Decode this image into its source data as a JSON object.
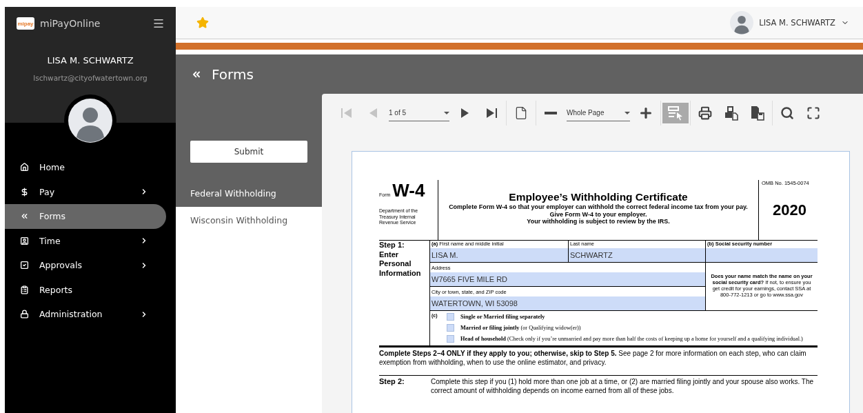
{
  "app": {
    "logo_text": "mipay",
    "name": "miPayOnline"
  },
  "user": {
    "name": "LISA M. SCHWARTZ",
    "email": "lschwartz@cityofwatertown.org"
  },
  "nav": [
    {
      "label": "Home",
      "kind": "home",
      "submenu": false,
      "selected": false
    },
    {
      "label": "Pay",
      "kind": "dollar",
      "submenu": true,
      "selected": false
    },
    {
      "label": "Forms",
      "kind": "rewind",
      "submenu": false,
      "selected": true
    },
    {
      "label": "Time",
      "kind": "badge",
      "submenu": true,
      "selected": false
    },
    {
      "label": "Approvals",
      "kind": "check",
      "submenu": true,
      "selected": false
    },
    {
      "label": "Reports",
      "kind": "clipboard",
      "submenu": false,
      "selected": false
    },
    {
      "label": "Administration",
      "kind": "lock",
      "submenu": true,
      "selected": false
    }
  ],
  "topbar": {
    "user_name": "LISA M. SCHWARTZ"
  },
  "page_title": "Forms",
  "submit_label": "Submit",
  "forms": [
    {
      "label": "Federal Withholding",
      "selected": true
    },
    {
      "label": "Wisconsin Withholding",
      "selected": false
    }
  ],
  "toolbar": [
    {
      "kind": "first",
      "disabled": true
    },
    {
      "kind": "prev",
      "disabled": true
    },
    {
      "kind": "select",
      "value": "1 of 5"
    },
    {
      "kind": "next",
      "disabled": false
    },
    {
      "kind": "last",
      "disabled": false
    },
    {
      "kind": "sep"
    },
    {
      "kind": "page",
      "disabled": false
    },
    {
      "kind": "sep"
    },
    {
      "kind": "zoomout",
      "disabled": false
    },
    {
      "kind": "select",
      "value": "Whole Page"
    },
    {
      "kind": "zoomin",
      "disabled": false
    },
    {
      "kind": "sep"
    },
    {
      "kind": "selecttool",
      "disabled": false,
      "selected": true
    },
    {
      "kind": "sep"
    },
    {
      "kind": "print",
      "disabled": false
    },
    {
      "kind": "download",
      "disabled": false
    },
    {
      "kind": "save",
      "disabled": false
    },
    {
      "kind": "sep"
    },
    {
      "kind": "search",
      "disabled": false
    },
    {
      "kind": "fullscreen",
      "disabled": false
    }
  ],
  "document": {
    "form_label": "Form",
    "form_number": "W-4",
    "department": "Department of the Treasury Internal Revenue Service",
    "title": "Employee’s Withholding Certificate",
    "instructions": [
      "Complete Form W-4 so that your employer can withhold the correct federal income tax from your pay.",
      "Give Form W-4 to your employer.",
      "Your withholding is subject to review by the IRS."
    ],
    "omb": "OMB No. 1545-0074",
    "year": "2020",
    "step1_label": "Step 1:",
    "step1_title": "Enter Personal Information",
    "name_fields": [
      {
        "label": "**(a)** First name and middle initial",
        "value": "LISA M."
      },
      {
        "label": "Last name",
        "value": "SCHWARTZ"
      },
      {
        "label": "**(b) Social security number**"
      }
    ],
    "address_fields": [
      {
        "label": "Address",
        "value": "W7665 FIVE MILE RD"
      },
      {
        "label": "City or town, state, and ZIP code",
        "value": "WATERTOWN, WI 53098"
      }
    ],
    "ssa_note": "**Does your name match the name on your social security card?** If not, to ensure you get credit for your earnings, contact SSA at 800-772-1213 or go to www.ssa.gov",
    "filing_label": "(c)",
    "filing_status": [
      {
        "label": "**Single or Married filing separately**",
        "checked": false
      },
      {
        "label": "**Married or filing jointly** (or Qualifying widow(er))",
        "checked": false
      },
      {
        "label": "**Head of household** (Check only if you’re unmarried and pay more than half the costs of keeping up a home for yourself and a qualifying individual.)",
        "checked": false
      }
    ],
    "note": "**Complete Steps 2–4 ONLY if they apply to you; otherwise, skip to Step 5.** See page 2 for more information on each step, who can claim exemption from withholding, when to use the online estimator, and privacy.",
    "step2_label": "Step 2:",
    "step2_text": "Complete this step if you (1) hold more than one job at a time, or (2) are married filing jointly and your spouse also works. The correct amount of withholding depends on income earned from all of these jobs."
  }
}
